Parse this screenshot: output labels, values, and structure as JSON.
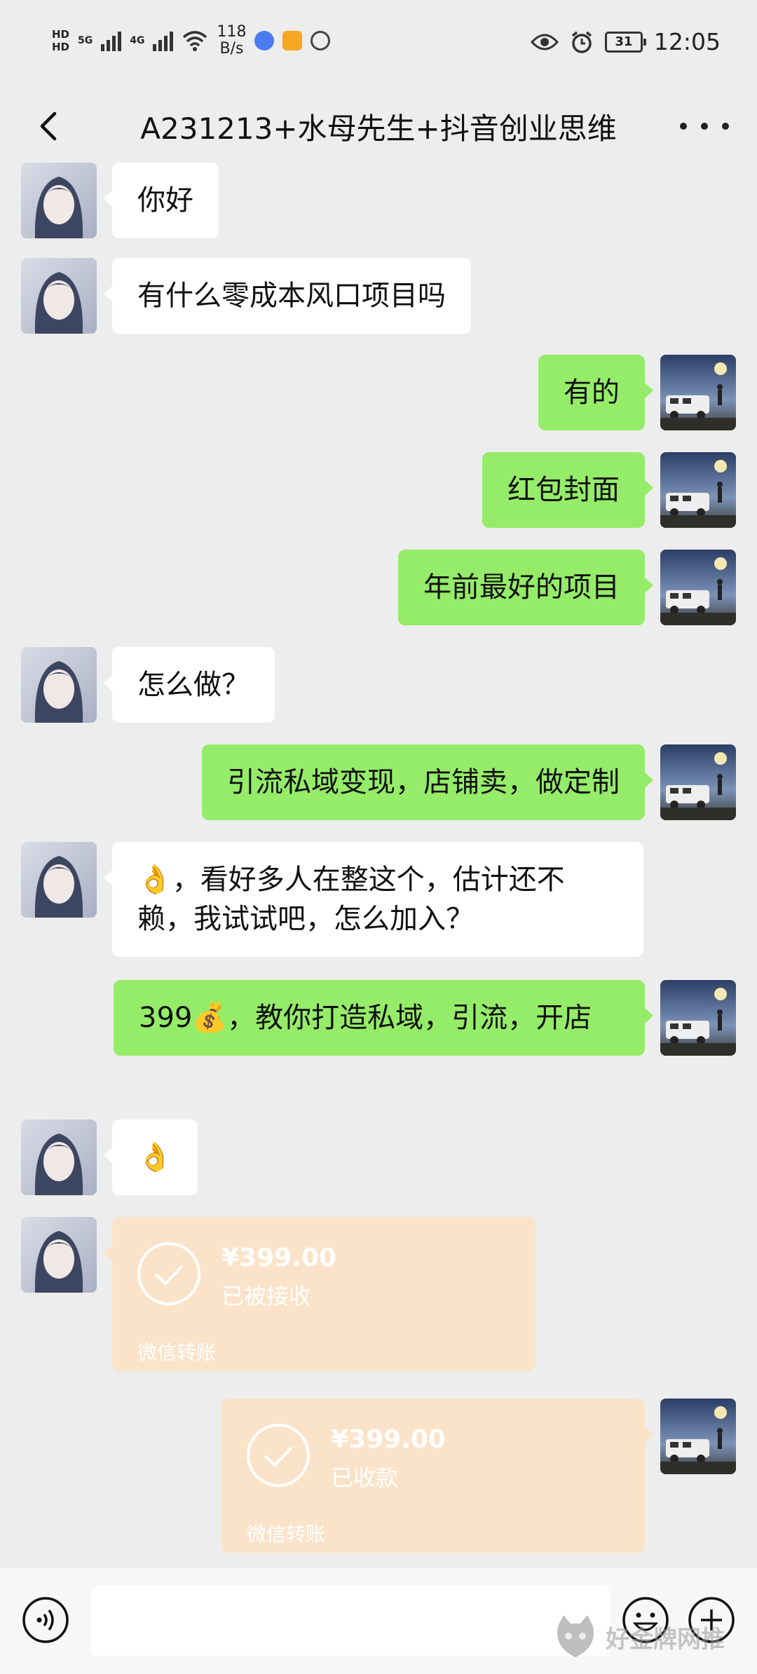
{
  "status_bar": {
    "hd1": "HD",
    "hd2": "HD",
    "sig1": "5G",
    "sig2": "4G",
    "speed_num": "118",
    "speed_unit": "B/s",
    "battery": "31",
    "time": "12:05"
  },
  "header": {
    "title": "A231213+水母先生+抖音创业思维"
  },
  "messages": [
    {
      "side": "left",
      "text": "你好"
    },
    {
      "side": "left",
      "text": "有什么零成本风口项目吗"
    },
    {
      "side": "right",
      "text": "有的"
    },
    {
      "side": "right",
      "text": "红包封面"
    },
    {
      "side": "right",
      "text": "年前最好的项目"
    },
    {
      "side": "left",
      "text": "怎么做？"
    },
    {
      "side": "right",
      "text": "引流私域变现，店铺卖，做定制"
    },
    {
      "side": "left",
      "text": "👌，看好多人在整这个，估计还不赖，我试试吧，怎么加入？"
    },
    {
      "side": "right",
      "text": "399💰，教你打造私域，引流，开店"
    },
    {
      "side": "left",
      "text": "👌"
    }
  ],
  "transfers": [
    {
      "side": "left",
      "amount": "¥399.00",
      "status": "已被接收",
      "brand": "微信转账"
    },
    {
      "side": "right",
      "amount": "¥399.00",
      "status": "已收款",
      "brand": "微信转账"
    }
  ],
  "watermark": "好金牌网推",
  "colors": {
    "bg": "#ededed",
    "bubble_right": "#95ec69",
    "bubble_left": "#ffffff",
    "transfer": "#fbe3c9"
  }
}
